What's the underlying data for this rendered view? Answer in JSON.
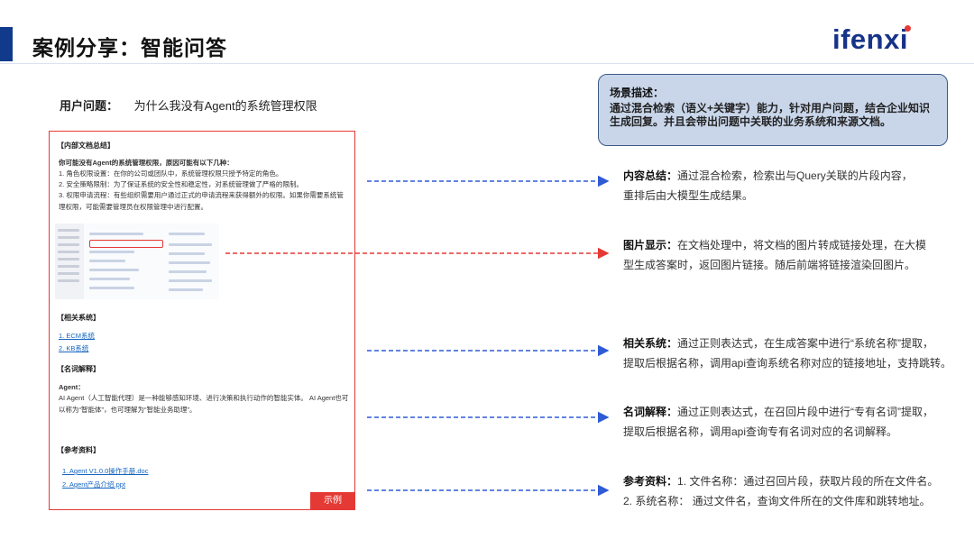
{
  "header": {
    "title": "案例分享：智能问答",
    "logo": "ifenxi"
  },
  "question": {
    "label": "用户问题：",
    "text": "为什么我没有Agent的系统管理权限"
  },
  "card": {
    "internal_summary_title": "【内部文档总结】",
    "intro": "你可能没有Agent的系统管理权限，原因可能有以下几种：",
    "reasons": [
      "1. 角色权限设置：在你的公司或团队中，系统管理权限只授予特定的角色。",
      "2. 安全策略限制：为了保证系统的安全性和稳定性，对系统管理做了严格的限制。",
      "3. 权限申请流程：有些组织需要用户通过正式的申请流程来获得额外的权限。如果你需要系统管理权限，可能需要管理员在权限管理中进行配置。"
    ],
    "related_title": "【相关系统】",
    "related_systems": [
      "1. ECM系统",
      "2. KB系统"
    ],
    "glossary_title": "【名词解释】",
    "glossary_term": "Agent：",
    "glossary_def": "AI Agent（人工智能代理）是一种能够感知环境、进行决策和执行动作的智能实体。 AI Agent也可以称为“智能体”，也可理解为“智能业务助理”。",
    "reference_title": "【参考资料】",
    "references": [
      "1. Agent V1.0.0操作手册.doc",
      "2. Agent产品介绍.ppt"
    ],
    "example_tag": "示例"
  },
  "scene": {
    "title": "场景描述：",
    "body": "通过混合检索（语义+关键字）能力，针对用户问题，结合企业知识生成回复。并且会带出问题中关联的业务系统和来源文档。"
  },
  "descriptions": [
    {
      "label": "内容总结：",
      "lines": [
        "通过混合检索，检索出与Query关联的片段内容，",
        "重排后由大模型生成结果。"
      ]
    },
    {
      "label": "图片显示：",
      "lines": [
        "在文档处理中，将文档的图片转成链接处理，在大模",
        "型生成答案时，返回图片链接。随后前端将链接渲染回图片。"
      ]
    },
    {
      "label": "相关系统：",
      "lines": [
        "通过正则表达式，在生成答案中进行“系统名称”提取，",
        "提取后根据名称，调用api查询系统名称对应的链接地址，支持跳转。"
      ]
    },
    {
      "label": "名词解释：",
      "lines": [
        "通过正则表达式，在召回片段中进行“专有名词”提取，",
        "提取后根据名称，调用api查询专有名词对应的名词解释。"
      ]
    },
    {
      "label": "参考资料：",
      "lines": [
        "1. 文件名称：通过召回片段，获取片段的所在文件名。",
        "2. 系统名称：   通过文件名，查询文件所在的文件库和跳转地址。"
      ]
    }
  ],
  "colors": {
    "brand": "#16338a",
    "accent_red": "#e53935",
    "arrow_blue": "#2f5bd6",
    "scene_fill": "#c9d6ea"
  }
}
